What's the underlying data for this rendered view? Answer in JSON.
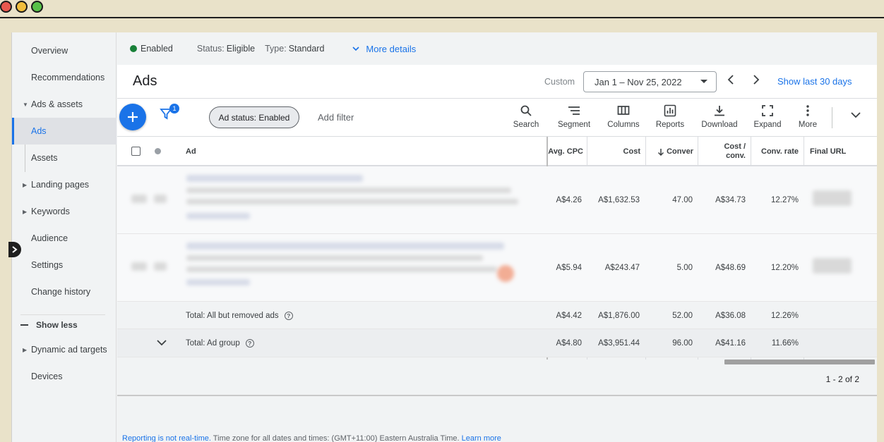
{
  "window_controls": [
    "close",
    "minimize",
    "maximize"
  ],
  "sidebar": {
    "items": [
      {
        "label": "Overview"
      },
      {
        "label": "Recommendations"
      },
      {
        "label": "Ads & assets",
        "expandable": true
      },
      {
        "label": "Ads",
        "active": true
      },
      {
        "label": "Assets"
      },
      {
        "label": "Landing pages",
        "expandable": true
      },
      {
        "label": "Keywords",
        "expandable": true
      },
      {
        "label": "Audience"
      },
      {
        "label": "Settings"
      },
      {
        "label": "Change history"
      }
    ],
    "show_less": "Show less",
    "more_items": [
      {
        "label": "Dynamic ad targets",
        "expandable": true
      },
      {
        "label": "Devices"
      }
    ]
  },
  "statusbar": {
    "enabled": "Enabled",
    "status_label": "Status:",
    "status_value": "Eligible",
    "type_label": "Type:",
    "type_value": "Standard",
    "more_details": "More details"
  },
  "header": {
    "title": "Ads",
    "custom_label": "Custom",
    "date_range": "Jan 1 – Nov 25, 2022",
    "show_last": "Show last 30 days"
  },
  "toolbar": {
    "filter_count": "1",
    "chip": "Ad status: Enabled",
    "add_filter": "Add filter",
    "tools": [
      "Search",
      "Segment",
      "Columns",
      "Reports",
      "Download",
      "Expand",
      "More"
    ]
  },
  "table": {
    "columns": {
      "ad": "Ad",
      "avg_cpc": "Avg. CPC",
      "cost": "Cost",
      "conversions": "Conver",
      "cost_per_conv_1": "Cost /",
      "cost_per_conv_2": "conv.",
      "conv_rate": "Conv. rate",
      "final_url": "Final URL"
    },
    "rows": [
      {
        "avg_cpc": "A$4.26",
        "cost": "A$1,632.53",
        "conversions": "47.00",
        "cost_per_conv": "A$34.73",
        "conv_rate": "12.27%"
      },
      {
        "avg_cpc": "A$5.94",
        "cost": "A$243.47",
        "conversions": "5.00",
        "cost_per_conv": "A$48.69",
        "conv_rate": "12.20%"
      }
    ],
    "totals": [
      {
        "label": "Total: All but removed ads",
        "avg_cpc": "A$4.42",
        "cost": "A$1,876.00",
        "conversions": "52.00",
        "cost_per_conv": "A$36.08",
        "conv_rate": "12.26%"
      },
      {
        "label": "Total: Ad group",
        "avg_cpc": "A$4.80",
        "cost": "A$3,951.44",
        "conversions": "96.00",
        "cost_per_conv": "A$41.16",
        "conv_rate": "11.66%"
      }
    ]
  },
  "pager": "1 - 2 of 2",
  "footer": {
    "link1": "Reporting is not real-time.",
    "text": " Time zone for all dates and times: (GMT+11:00) Eastern Australia Time. ",
    "link2": "Learn more"
  },
  "colors": {
    "accent": "#1a73e8",
    "enabled_green": "#188038",
    "frame_beige": "#e9e2c9"
  }
}
